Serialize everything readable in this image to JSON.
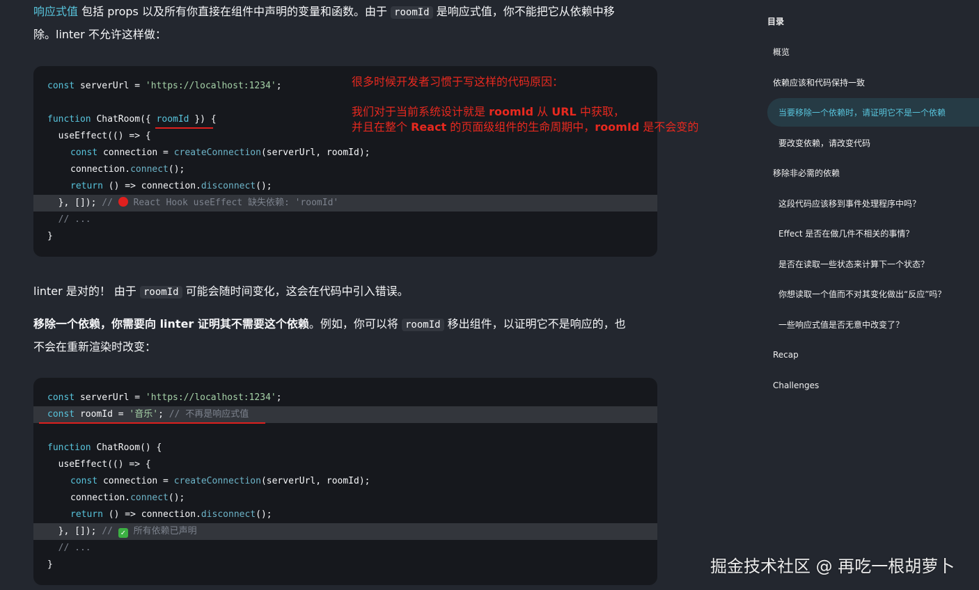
{
  "intro": {
    "link_text": "响应式值",
    "text1": " 包括 props 以及所有你直接在组件中声明的变量和函数。由于 ",
    "code": "roomId",
    "text2": " 是响应式值，你不能把它从依赖中移",
    "line2": "除。linter 不允许这样做："
  },
  "code1": {
    "l1_kw": "const",
    "l1_pl": " serverUrl = ",
    "l1_str": "'https://localhost:1234'",
    "l1_end": ";",
    "l3_kw": "function",
    "l3_pl1": " ChatRoom({ ",
    "l3_param": "roomId",
    "l3_pl2": " }) {",
    "l4": "  useEffect(() => {",
    "l5_kw": "const",
    "l5_pl1": " connection = ",
    "l5_fn": "createConnection",
    "l5_pl2": "(serverUrl, roomId);",
    "l6_pl": "connection.",
    "l6_fn": "connect",
    "l6_end": "();",
    "l7_kw": "return",
    "l7_pl": " () => connection.",
    "l7_fn": "disconnect",
    "l7_end": "();",
    "l8_pl": "  }, []); ",
    "l8_cm1": "// ",
    "l8_cm2": " React Hook useEffect 缺失依赖: 'roomId'",
    "l9_cm": "  // ...",
    "l10": "}"
  },
  "annotation": {
    "line1": "很多时候开发者习惯于写这样的代码原因：",
    "l2a": "我们对于当前系统设计就是 ",
    "l2b": "roomId",
    "l2c": " 从 ",
    "l2d": "URL",
    "l2e": "  中获取，",
    "l3a": "并且在整个 ",
    "l3b": "React",
    "l3c": " 的页面级组件的生命周期中，",
    "l3d": "roomId",
    "l3e": " 是不会变的"
  },
  "para2": {
    "text1": "linter 是对的！ 由于 ",
    "code": "roomId",
    "text2": " 可能会随时间变化，这会在代码中引入错误。"
  },
  "para3": {
    "bold": "移除一个依赖，你需要向 linter 证明其不需要这个依赖",
    "text1": "。例如，你可以将 ",
    "code": "roomId",
    "text2": " 移出组件，以证明它不是响应的，也",
    "line2": "不会在重新渲染时改变："
  },
  "code2": {
    "l1_kw": "const",
    "l1_pl": " serverUrl = ",
    "l1_str": "'https://localhost:1234'",
    "l1_end": ";",
    "l2_kw": "const",
    "l2_pl": " roomId = ",
    "l2_str": "'音乐'",
    "l2_end": "; ",
    "l2_cm": "// 不再是响应式值",
    "l4_kw": "function",
    "l4_pl": " ChatRoom() {",
    "l5": "  useEffect(() => {",
    "l6_kw": "const",
    "l6_pl1": " connection = ",
    "l6_fn": "createConnection",
    "l6_pl2": "(serverUrl, roomId);",
    "l7_pl": "connection.",
    "l7_fn": "connect",
    "l7_end": "();",
    "l8_kw": "return",
    "l8_pl": " () => connection.",
    "l8_fn": "disconnect",
    "l8_end": "();",
    "l9_pl": "  }, []); ",
    "l9_cm1": "// ",
    "l9_check": "✓",
    "l9_cm2": " 所有依赖已声明",
    "l10_cm": "  // ...",
    "l11": "}"
  },
  "toc": {
    "title": "目录",
    "items": [
      "概览",
      "依赖应该和代码保持一致",
      "当要移除一个依赖时，请证明它不是一个依赖",
      "要改变依赖，请改变代码",
      "移除非必需的依赖",
      "这段代码应该移到事件处理程序中吗？",
      "Effect 是否在做几件不相关的事情？",
      "是否在读取一些状态来计算下一个状态？",
      "你想读取一个值而不对其变化做出“反应”吗？",
      "一些响应式值是否无意中改变了？",
      "Recap",
      "Challenges"
    ]
  },
  "watermark": "掘金技术社区 @ 再吃一根胡萝卜",
  "colors": {
    "accent": "#58c4dc",
    "annotation_red": "#e7291f",
    "background": "#23272f",
    "code_bg": "#16181d"
  }
}
